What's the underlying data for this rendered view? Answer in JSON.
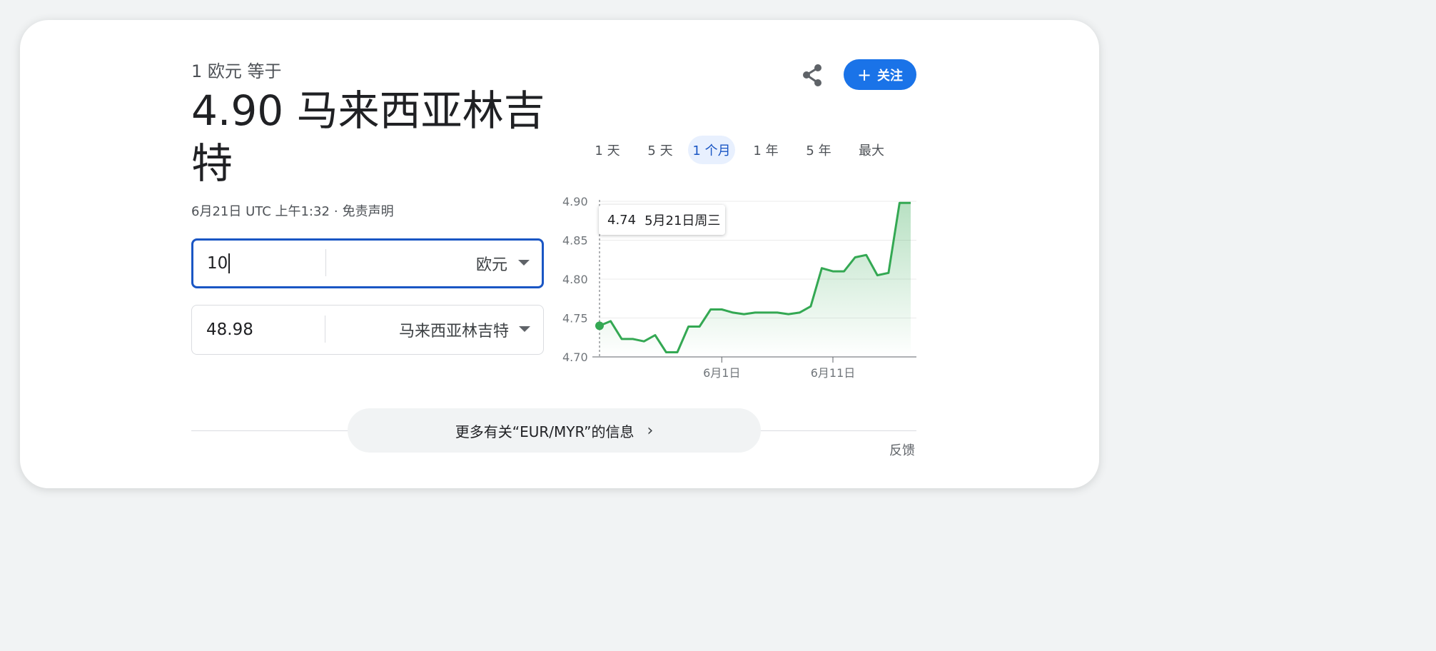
{
  "header": {
    "lead": "1 欧元 等于",
    "value": "4.90 马来西亚林吉特",
    "timestamp": "6月21日 UTC 上午1:32",
    "separator": "·",
    "disclaimer": "免责声明"
  },
  "actions": {
    "share_icon": "share-icon",
    "follow_icon": "plus-icon",
    "follow_label": "关注",
    "accent": "#1a73e8"
  },
  "converter": {
    "from": {
      "amount": "10",
      "currency": "欧元"
    },
    "to": {
      "amount": "48.98",
      "currency": "马来西亚林吉特"
    }
  },
  "ranges": [
    {
      "label": "1 天",
      "selected": false
    },
    {
      "label": "5 天",
      "selected": false
    },
    {
      "label": "1 个月",
      "selected": true
    },
    {
      "label": "1 年",
      "selected": false
    },
    {
      "label": "5 年",
      "selected": false
    },
    {
      "label": "最大",
      "selected": false
    }
  ],
  "tooltip": {
    "value": "4.74",
    "date": "5月21日周三"
  },
  "chart_data": {
    "type": "area",
    "color": "#34a853",
    "ylim": [
      4.7,
      4.9
    ],
    "y_ticks": [
      "4.90",
      "4.85",
      "4.80",
      "4.75",
      "4.70"
    ],
    "x_ticks": [
      {
        "label": "6月1日",
        "index": 11
      },
      {
        "label": "6月11日",
        "index": 21
      }
    ],
    "grid": true,
    "values": [
      4.74,
      4.746,
      4.723,
      4.723,
      4.72,
      4.728,
      4.706,
      4.706,
      4.739,
      4.739,
      4.761,
      4.761,
      4.757,
      4.755,
      4.757,
      4.757,
      4.757,
      4.755,
      4.757,
      4.765,
      4.814,
      4.81,
      4.81,
      4.828,
      4.831,
      4.805,
      4.808,
      4.898,
      4.898
    ],
    "highlight_index": 0
  },
  "footer": {
    "more": "更多有关“EUR/MYR”的信息",
    "more_icon": "chevron-right-icon",
    "feedback": "反馈"
  }
}
